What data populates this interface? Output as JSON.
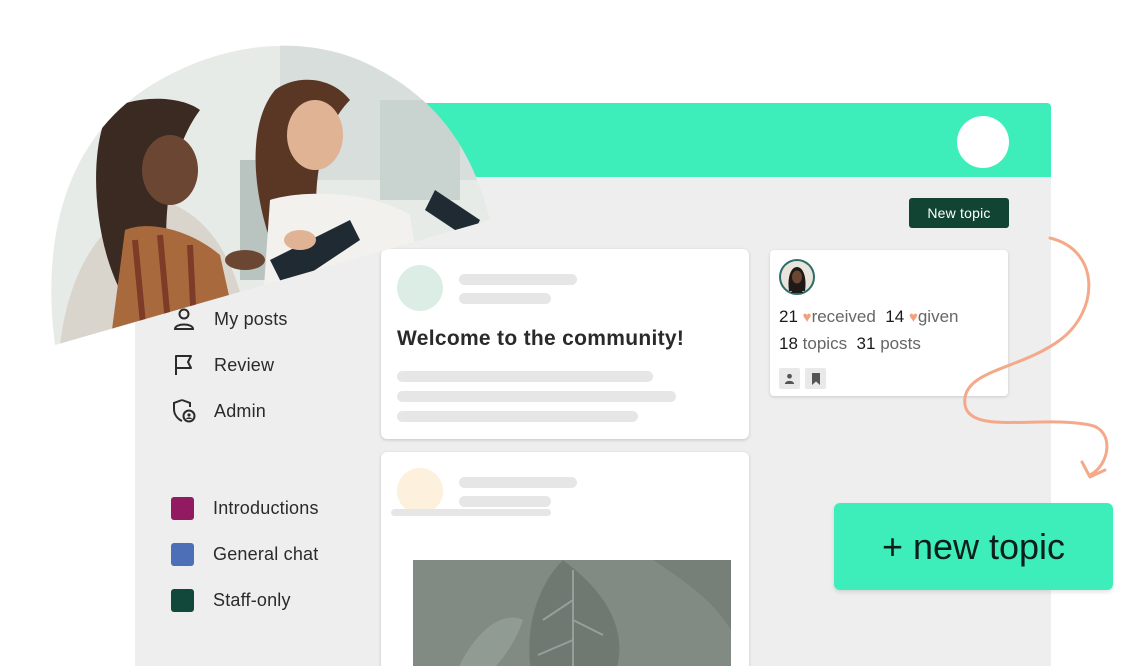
{
  "header": {
    "new_topic_label": "New topic"
  },
  "sidebar": {
    "items": [
      {
        "label": "My posts",
        "icon": "user-icon"
      },
      {
        "label": "Review",
        "icon": "flag-icon"
      },
      {
        "label": "Admin",
        "icon": "shield-icon"
      }
    ],
    "categories": [
      {
        "label": "Introductions",
        "color": "#921a61"
      },
      {
        "label": "General chat",
        "color": "#4d6fb8"
      },
      {
        "label": "Staff-only",
        "color": "#12473c"
      }
    ]
  },
  "feed": {
    "first_post": {
      "title": "Welcome to the community!"
    }
  },
  "profile": {
    "received_count": "21",
    "received_label": "received",
    "given_count": "14",
    "given_label": "given",
    "topics_count": "18",
    "topics_label": "topics",
    "posts_count": "31",
    "posts_label": "posts"
  },
  "cta": {
    "label": "+ new topic"
  },
  "colors": {
    "accent": "#3deeba",
    "dark_green": "#124434",
    "heart": "#f0a27f",
    "arrow": "#f4a98a"
  }
}
